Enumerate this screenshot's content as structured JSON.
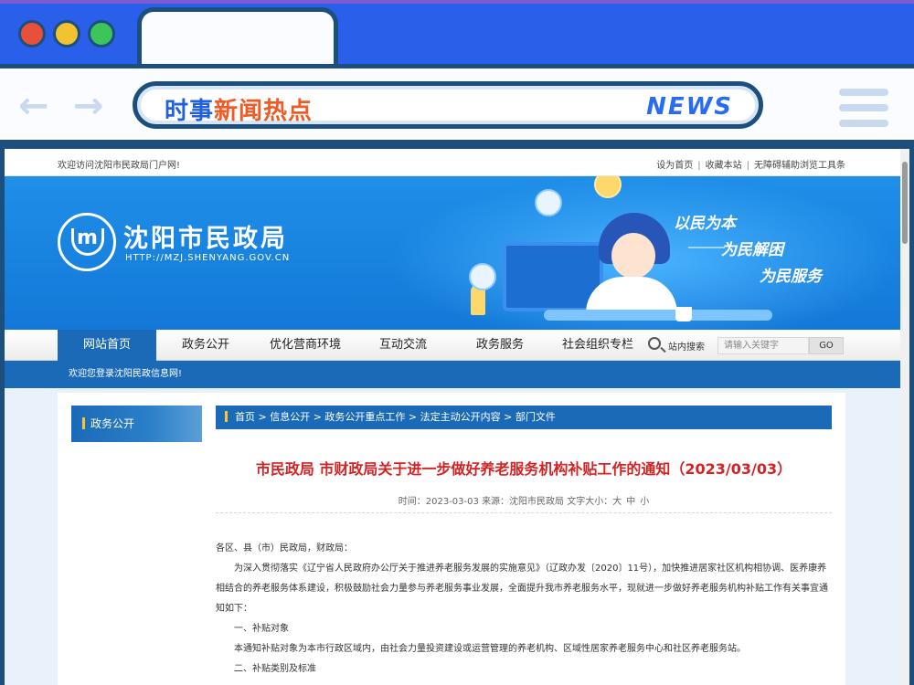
{
  "header_graphic": {
    "title_part1": "时事",
    "title_part2": "新闻热点",
    "badge": "NEWS"
  },
  "icons": {
    "back": "back-arrow-icon",
    "forward": "forward-arrow-icon",
    "menu": "hamburger-menu-icon",
    "search": "search-icon"
  },
  "topbar": {
    "welcome": "欢迎访问沈阳市民政局门户网!",
    "links": [
      "设为首页",
      "收藏本站",
      "无障碍辅助浏览工具条"
    ]
  },
  "banner": {
    "site_name": "沈阳市民政局",
    "site_url": "HTTP://MZJ.SHENYANG.GOV.CN",
    "slogans": [
      "以民为本",
      "为民解困",
      "为民服务"
    ]
  },
  "nav": {
    "items": [
      "网站首页",
      "政务公开",
      "优化营商环境",
      "互动交流",
      "政务服务",
      "社会组织专栏"
    ],
    "search_label": "站内搜索",
    "search_placeholder": "请输入关键字",
    "go": "GO"
  },
  "login_bar": "欢迎您登录沈阳民政信息网!",
  "sidebar": {
    "title": "政务公开"
  },
  "breadcrumb": "首页 > 信息公开 > 政务公开重点工作 > 法定主动公开内容 > 部门文件",
  "article": {
    "title": "市民政局 市财政局关于进一步做好养老服务机构补贴工作的通知（2023/03/03）",
    "meta": {
      "time": "时间：2023-03-03",
      "source": "来源：沈阳市民政局",
      "font_label": "文字大小：",
      "sizes": [
        "大",
        "中",
        "小"
      ]
    },
    "body": [
      "各区、县（市）民政局，财政局：",
      "为深入贯彻落实《辽宁省人民政府办公厅关于推进养老服务发展的实施意见》（辽政办发〔2020〕11号），加快推进居家社区机构相协调、医养康养相结合的养老服务体系建设，积极鼓励社会力量参与养老服务事业发展，全面提升我市养老服务水平，现就进一步做好养老服务机构补贴工作有关事宜通知如下：",
      "一、补贴对象",
      "本通知补贴对象为本市行政区域内，由社会力量投资建设或运营管理的养老机构、区域性居家养老服务中心和社区养老服务站。",
      "二、补贴类别及标准"
    ]
  },
  "colors": {
    "frame_dark": "#1d4f7e",
    "frame_blue": "#2a5fe9",
    "site_blue": "#1a6ab8",
    "title_red": "#d22424",
    "accent_orange": "#f05a24"
  }
}
